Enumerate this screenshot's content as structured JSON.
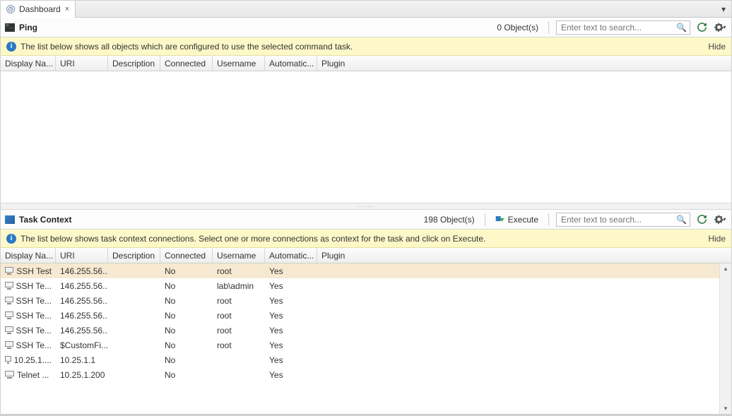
{
  "tab": {
    "title": "Dashboard",
    "close": "×",
    "menu": "▾"
  },
  "top": {
    "title": "Ping",
    "count": "0 Object(s)",
    "search_placeholder": "Enter text to search...",
    "info_text": "The list below shows all objects which are configured to use the selected command task.",
    "hide": "Hide"
  },
  "columns": {
    "display": "Display Na...",
    "uri": "URI",
    "desc": "Description",
    "conn": "Connected",
    "user": "Username",
    "auto": "Automatic...",
    "plugin": "Plugin"
  },
  "bottom": {
    "title": "Task Context",
    "count": "198 Object(s)",
    "execute": "Execute",
    "search_placeholder": "Enter text to search...",
    "info_text": "The list below shows task context connections. Select one or more connections as context for the task and click on Execute.",
    "hide": "Hide"
  },
  "rows": [
    {
      "display": "SSH Test",
      "uri": "146.255.56....",
      "desc": "",
      "conn": "No",
      "user": "root",
      "auto": "Yes",
      "selected": true
    },
    {
      "display": "SSH Te...",
      "uri": "146.255.56....",
      "desc": "",
      "conn": "No",
      "user": "lab\\admin",
      "auto": "Yes"
    },
    {
      "display": "SSH Te...",
      "uri": "146.255.56....",
      "desc": "",
      "conn": "No",
      "user": "root",
      "auto": "Yes"
    },
    {
      "display": "SSH Te...",
      "uri": "146.255.56....",
      "desc": "",
      "conn": "No",
      "user": "root",
      "auto": "Yes"
    },
    {
      "display": "SSH Te...",
      "uri": "146.255.56....",
      "desc": "",
      "conn": "No",
      "user": "root",
      "auto": "Yes"
    },
    {
      "display": "SSH Te...",
      "uri": "$CustomFi...",
      "desc": "",
      "conn": "No",
      "user": "root",
      "auto": "Yes"
    },
    {
      "display": "10.25.1....",
      "uri": "10.25.1.1",
      "desc": "",
      "conn": "No",
      "user": "",
      "auto": "Yes"
    },
    {
      "display": "Telnet ...",
      "uri": "10.25.1.200",
      "desc": "",
      "conn": "No",
      "user": "",
      "auto": "Yes"
    }
  ]
}
